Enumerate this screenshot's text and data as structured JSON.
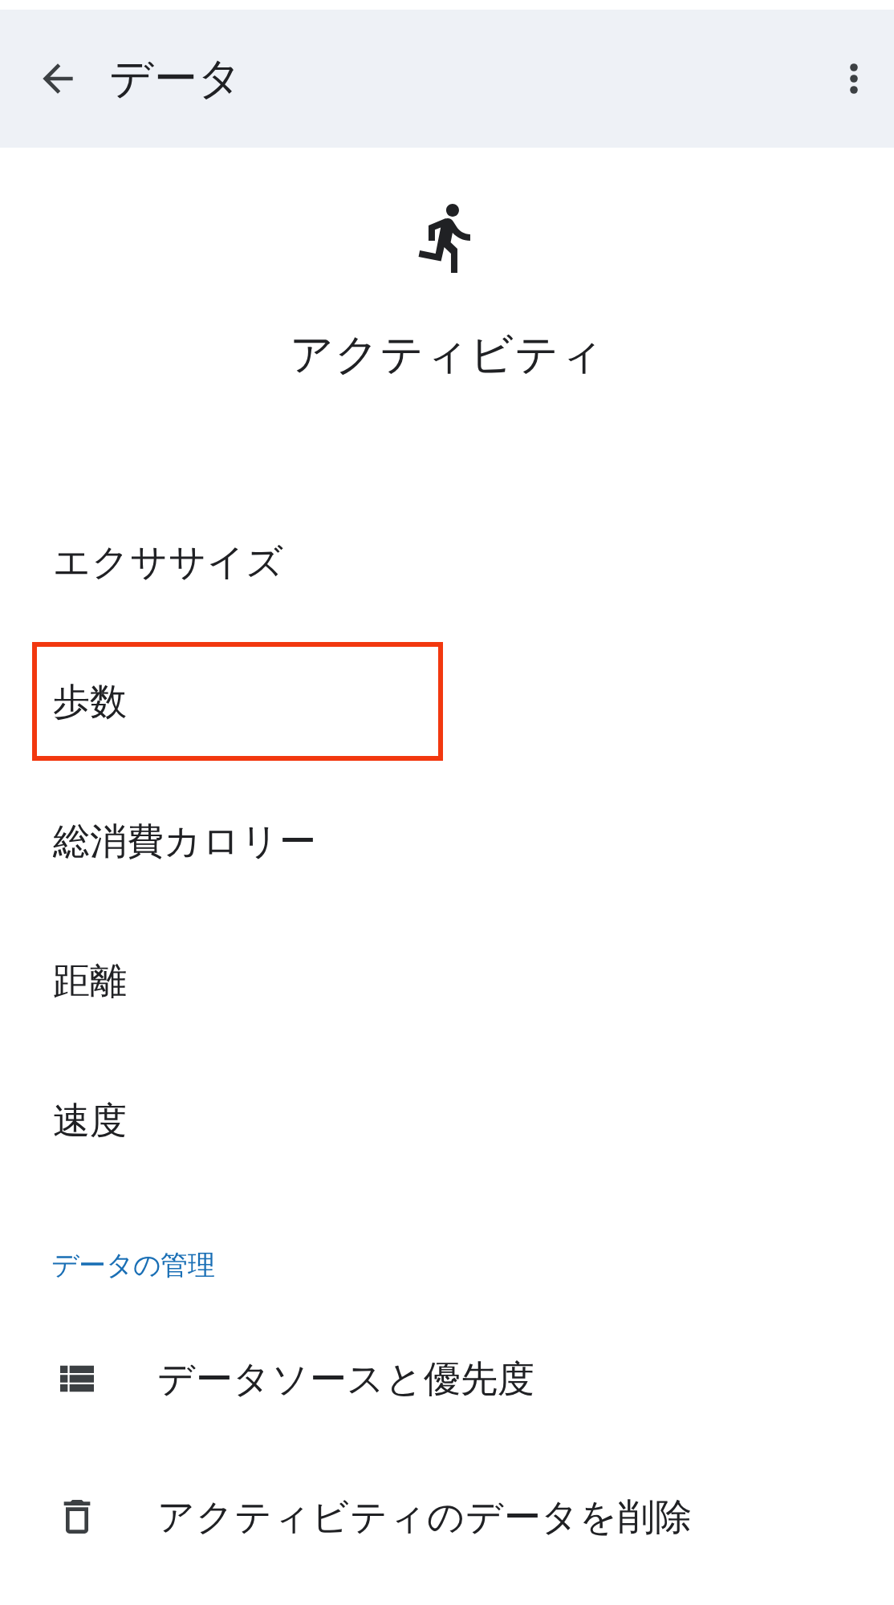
{
  "app_bar": {
    "title": "データ"
  },
  "header": {
    "title": "アクティビティ"
  },
  "items": [
    {
      "label": "エクササイズ",
      "highlighted": false
    },
    {
      "label": "歩数",
      "highlighted": true
    },
    {
      "label": "総消費カロリー",
      "highlighted": false
    },
    {
      "label": "距離",
      "highlighted": false
    },
    {
      "label": "速度",
      "highlighted": false
    }
  ],
  "section": {
    "title": "データの管理",
    "items": [
      {
        "label": "データソースと優先度",
        "kind": "sources"
      },
      {
        "label": "アクティビティのデータを削除",
        "kind": "delete"
      }
    ]
  }
}
